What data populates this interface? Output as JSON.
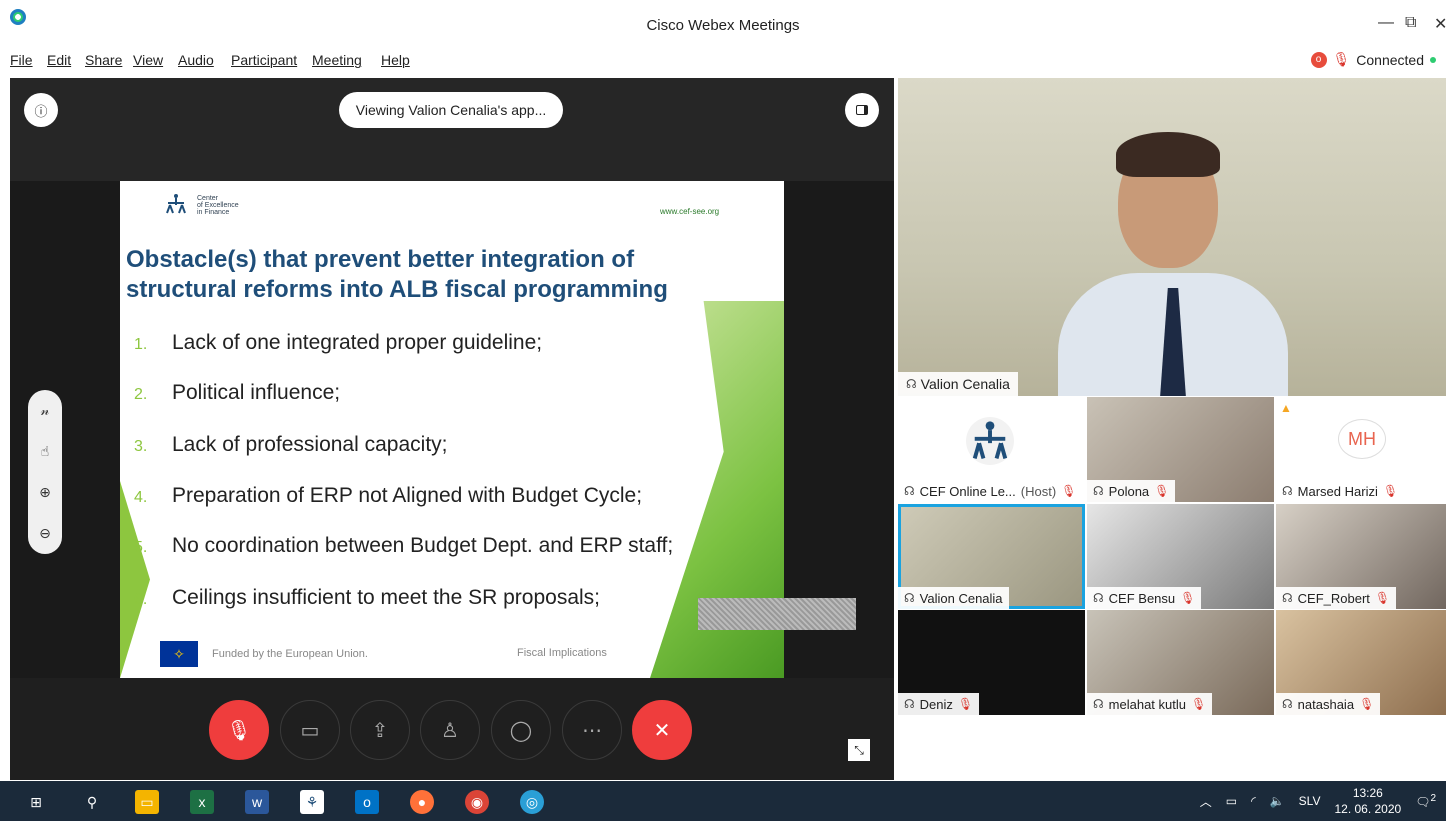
{
  "window": {
    "title": "Cisco Webex Meetings",
    "minimize": "—",
    "restore": "⧉",
    "close": "✕"
  },
  "menu": [
    "File",
    "Edit",
    "Share",
    "View",
    "Audio",
    "Participant",
    "Meeting",
    "Help"
  ],
  "status": {
    "badge": "o",
    "mute_glyph": "🎙",
    "text": "Connected"
  },
  "stage": {
    "info": "ⓘ",
    "viewing_label": "Viewing Valion Cenalia's app..."
  },
  "slide": {
    "org_name": "Center\nof Excellence\nin Finance",
    "url": "www.cef-see.org",
    "title_line1": "Obstacle(s) that prevent better integration of",
    "title_line2": "structural reforms into ALB fiscal programming",
    "items": [
      {
        "num": "1.",
        "text": "Lack of one integrated proper guideline;"
      },
      {
        "num": "2.",
        "text": "Political influence;"
      },
      {
        "num": "3.",
        "text": "Lack of professional capacity;"
      },
      {
        "num": "4.",
        "text": "Preparation of ERP not Aligned with Budget Cycle;"
      },
      {
        "num": "5.",
        "text": "No coordination between Budget Dept. and ERP staff;"
      },
      {
        "num": "6.",
        "text": "Ceilings insufficient to meet the SR proposals;"
      }
    ],
    "funded": "Funded by the European Union.",
    "footer_right": "Fiscal Implications"
  },
  "speaker": {
    "name": "Valion Cenalia"
  },
  "participants": [
    {
      "name": "CEF Online Le...",
      "suffix": "(Host)",
      "muted": true,
      "kind": "logo"
    },
    {
      "name": "Polona",
      "suffix": "",
      "muted": true,
      "kind": "video"
    },
    {
      "name": "Marsed Harizi",
      "suffix": "",
      "muted": true,
      "kind": "initials",
      "initials": "MH"
    },
    {
      "name": "Valion Cenalia",
      "suffix": "",
      "muted": false,
      "kind": "video",
      "active": true
    },
    {
      "name": "CEF Bensu",
      "suffix": "",
      "muted": true,
      "kind": "video"
    },
    {
      "name": "CEF_Robert",
      "suffix": "",
      "muted": true,
      "kind": "video"
    },
    {
      "name": "Deniz",
      "suffix": "",
      "muted": true,
      "kind": "dark"
    },
    {
      "name": "melahat kutlu",
      "suffix": "",
      "muted": true,
      "kind": "video"
    },
    {
      "name": "natashaia",
      "suffix": "",
      "muted": true,
      "kind": "video"
    }
  ],
  "taskbar": {
    "lang": "SLV",
    "time": "13:26",
    "date": "12. 06. 2020",
    "notif_count": "2"
  },
  "colors": {
    "accent_red": "#ef3d3d",
    "active_border": "#1aa3e0",
    "slide_title": "#1f4e79",
    "slide_green": "#8dc63f"
  }
}
